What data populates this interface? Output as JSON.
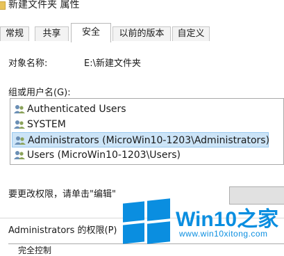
{
  "window": {
    "title": "新建文件夹 属性"
  },
  "tabs": [
    {
      "label": "常规"
    },
    {
      "label": "共享"
    },
    {
      "label": "安全"
    },
    {
      "label": "以前的版本"
    },
    {
      "label": "自定义"
    }
  ],
  "active_tab": "安全",
  "object": {
    "label": "对象名称:",
    "value": "E:\\新建文件夹"
  },
  "groups": {
    "label": "组或用户名(G):",
    "items": [
      {
        "name": "Authenticated Users",
        "selected": false,
        "icon": "users-group-icon"
      },
      {
        "name": "SYSTEM",
        "selected": false,
        "icon": "users-group-icon"
      },
      {
        "name": "Administrators (MicroWin10-1203\\Administrators)",
        "selected": true,
        "icon": "users-group-icon"
      },
      {
        "name": "Users (MicroWin10-1203\\Users)",
        "selected": false,
        "icon": "users-group-icon"
      }
    ]
  },
  "hint": "要更改权限，请单击\"编辑\"",
  "permissions": {
    "header": "Administrators 的权限(P)",
    "first_row": "完全控制"
  },
  "watermark": {
    "brand": "Win10",
    "brand_suffix": "之家",
    "url": "www.win10xitong.com",
    "color": "#0a8ee0"
  }
}
